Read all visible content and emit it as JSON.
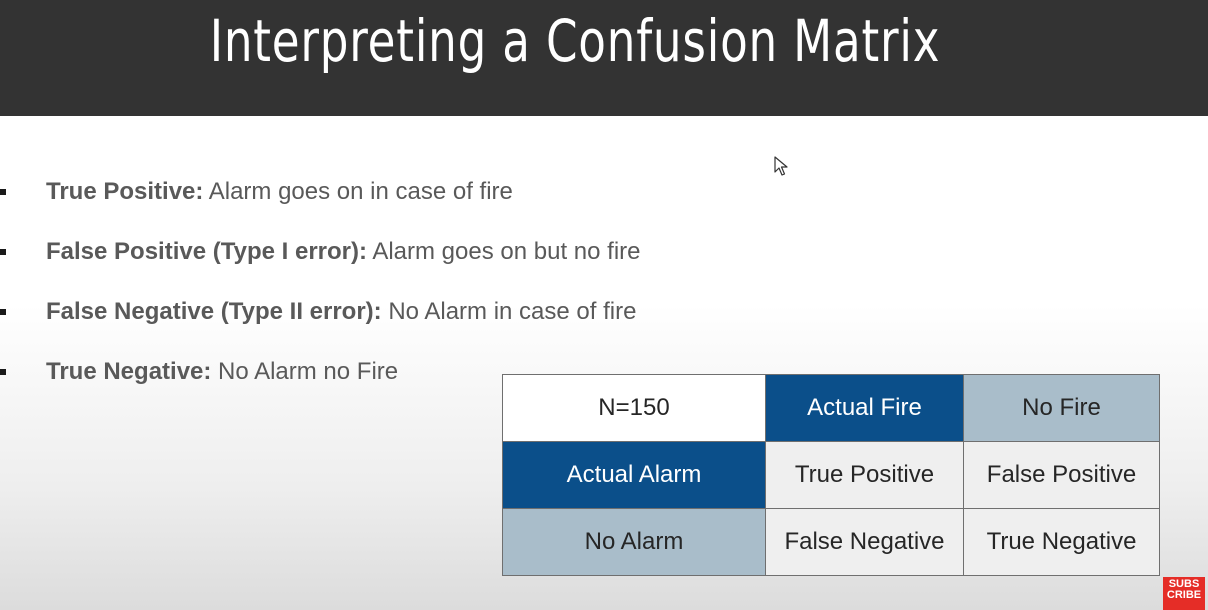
{
  "slide": {
    "title": "Interpreting a Confusion Matrix"
  },
  "bullets": [
    {
      "term": "True Positive:",
      "text": " Alarm goes on in case of fire"
    },
    {
      "term": "False Positive (Type I error):",
      "text": " Alarm goes on but no fire"
    },
    {
      "term": "False Negative (Type II error):",
      "text": " No Alarm in case of fire"
    },
    {
      "term": "True Negative:",
      "text": " No Alarm no Fire"
    }
  ],
  "matrix": {
    "corner": "N=150",
    "col_headers": [
      "Actual Fire",
      "No Fire"
    ],
    "rows": [
      {
        "header": "Actual Alarm",
        "cells": [
          "True Positive",
          "False Positive"
        ]
      },
      {
        "header": "No Alarm",
        "cells": [
          "False Negative",
          "True Negative"
        ]
      }
    ]
  },
  "badge": {
    "line1": "SUBS",
    "line2": "CRIBE"
  },
  "colors": {
    "header_bg": "#333333",
    "matrix_dark": "#0b4f8a",
    "matrix_steel": "#a9bdca",
    "matrix_light": "#efefef",
    "badge_red": "#e52d27"
  },
  "icons": {
    "cursor": "mouse-pointer-icon",
    "badge": "subscribe-badge-icon"
  }
}
